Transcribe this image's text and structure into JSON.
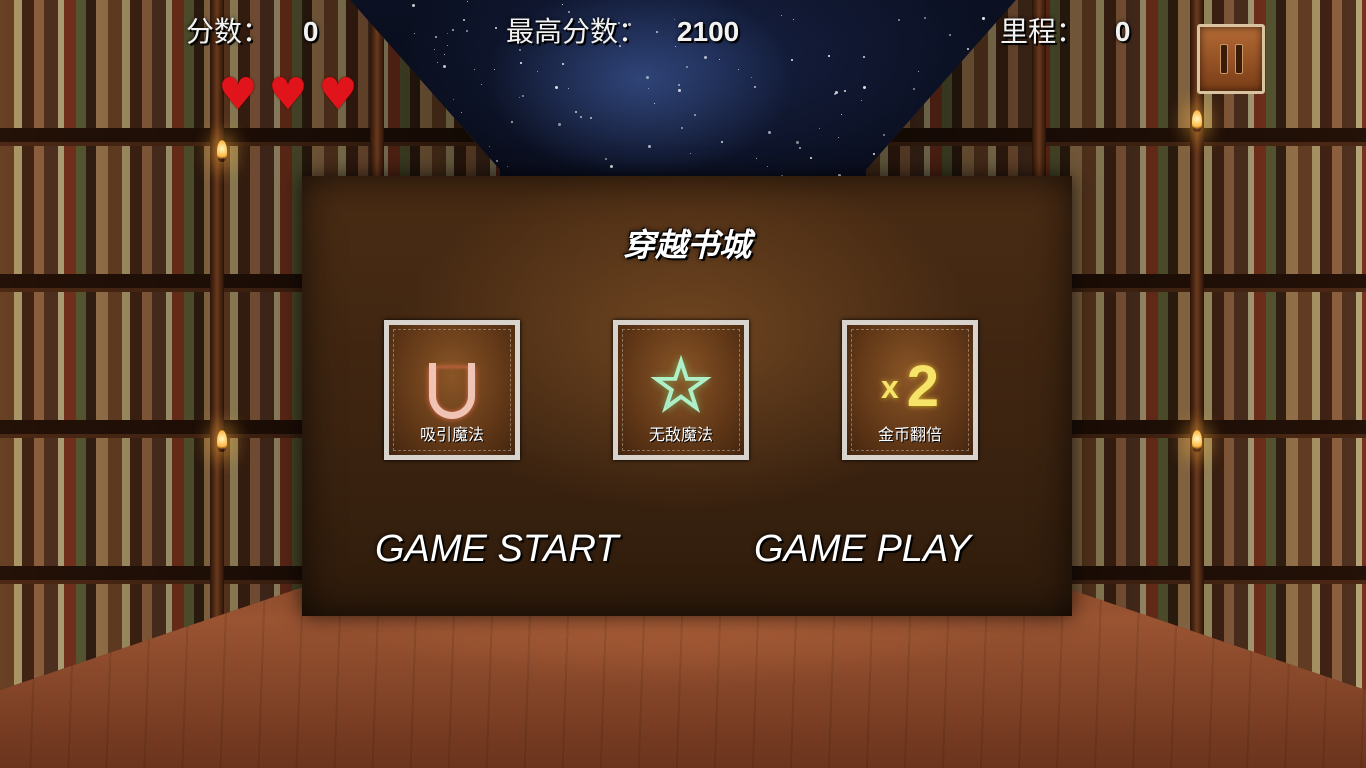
{
  "hud": {
    "score_label": "分数：",
    "score_value": "0",
    "best_label": "最高分数：",
    "best_value": "2100",
    "distance_label": "里程：",
    "distance_value": "0",
    "lives": 3,
    "heart_color": "#e0141a"
  },
  "panel": {
    "title": "穿越书城",
    "powerups": [
      {
        "name": "magnet",
        "icon": "magnet-icon",
        "label": "吸引魔法"
      },
      {
        "name": "invincible",
        "icon": "star-icon",
        "label": "无敌魔法",
        "glyph": "☆"
      },
      {
        "name": "double-coins",
        "icon": "x2-icon",
        "label": "金币翻倍",
        "multiplier_symbol": "x",
        "multiplier_value": "2"
      }
    ],
    "start_label": "GAME START",
    "play_label": "GAME PLAY"
  },
  "pause_icon": "pause-icon"
}
